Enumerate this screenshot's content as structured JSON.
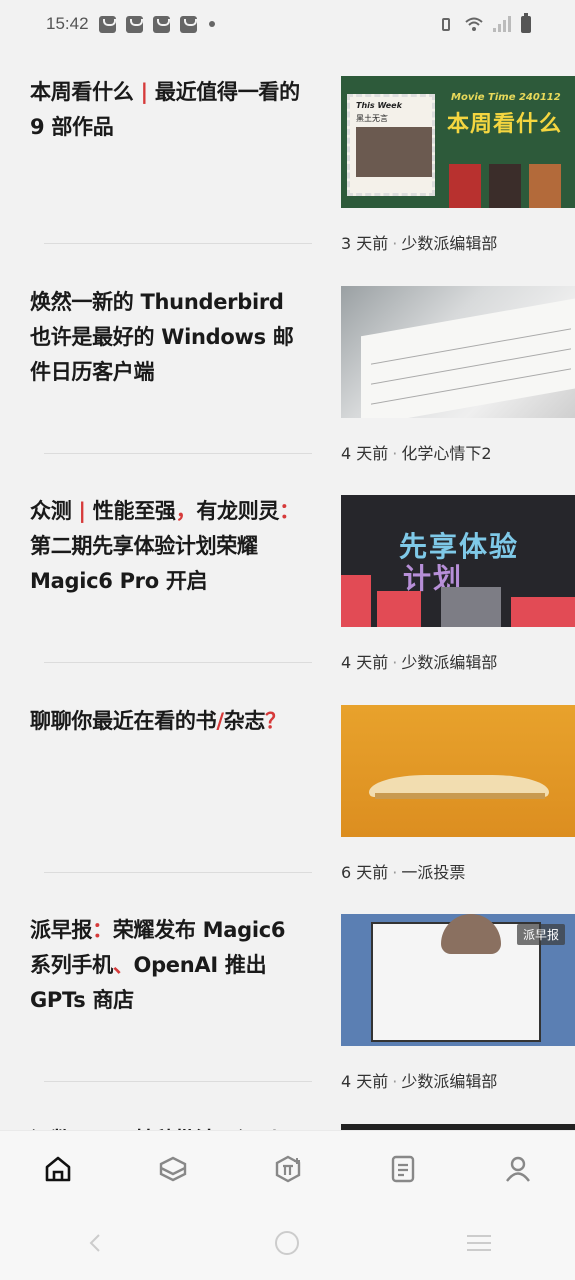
{
  "status_bar": {
    "time": "15:42"
  },
  "articles": [
    {
      "title_parts": [
        "本周看什么 ",
        "|",
        " 最近值得一看的 9 部作品"
      ],
      "time_ago": "3 天前",
      "author": "少数派编辑部",
      "thumb": {
        "line1": "This Week",
        "line2": "黑土无言",
        "line3": "Movie Time 240112",
        "line4": "本周看什么"
      }
    },
    {
      "title_parts": [
        "焕然一新的 Thunderbird 也许是最好的 Windows 邮件日历客户端"
      ],
      "time_ago": "4 天前",
      "author": "化学心情下2"
    },
    {
      "title_parts": [
        "众测 ",
        "|",
        " 性能至强",
        "，",
        "有龙则灵",
        "：",
        "第二期先享体验计划荣耀Magic6 Pro 开启"
      ],
      "time_ago": "4 天前",
      "author": "少数派编辑部",
      "thumb": {
        "line1": "先享体验",
        "line2": "计划"
      }
    },
    {
      "title_parts": [
        "聊聊你最近在看的书",
        "/",
        "杂志",
        "？"
      ],
      "time_ago": "6 天前",
      "author": "一派投票"
    },
    {
      "title_parts": [
        "派早报",
        "：",
        "荣耀发布 Magic6 系列手机",
        "、",
        "OpenAI 推出 GPTs 商店"
      ],
      "time_ago": "4 天前",
      "author": "少数派编辑部",
      "badge": "派早报"
    },
    {
      "title_parts": [
        "记数正口，林秋批汁一记以"
      ]
    }
  ],
  "colors": {
    "accent": "#d63a3a",
    "background": "#f2f2f2"
  },
  "tab_bar": {
    "tabs": [
      "home-icon",
      "matrix-icon",
      "pi-plus-icon",
      "notes-icon",
      "profile-icon"
    ]
  },
  "nav_bar": {
    "buttons": [
      "back-icon",
      "home-circle-icon",
      "menu-icon"
    ]
  }
}
